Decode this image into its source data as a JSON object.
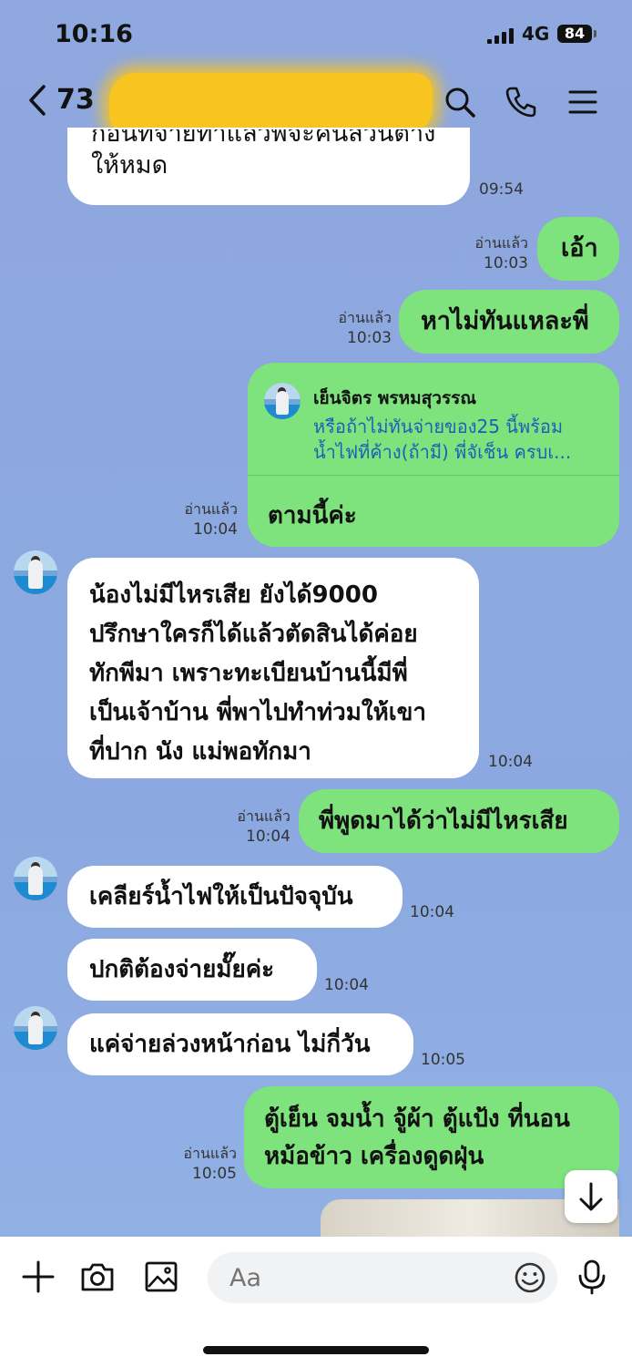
{
  "status": {
    "time": "10:16",
    "network": "4G",
    "battery": "84"
  },
  "header": {
    "unread_count": "73"
  },
  "messages": {
    "m1": {
      "text_line1": "ก่อนที่จ่ายทำแล้วพี่จะคืนส่วนต่าง",
      "text_line2": "ให้หมด",
      "time": "09:54"
    },
    "m2": {
      "text": "เอ้า",
      "read": "อ่านแล้ว",
      "time": "10:03"
    },
    "m3": {
      "text": "หาไม่ทันแหละพี่",
      "read": "อ่านแล้ว",
      "time": "10:03"
    },
    "m4": {
      "reply_name": "เย็นจิตร พรหมสุวรรณ",
      "reply_line1": "หรือถ้าไม่ทันจ่ายของ25 นี้พร้อม",
      "reply_line2": "น้ำไฟที่ค้าง(ถ้ามี) พี่จัเช็น ครบเ...",
      "text": "ตามนี้ค่ะ",
      "read": "อ่านแล้ว",
      "time": "10:04"
    },
    "m5": {
      "lines": [
        "น้องไม่มีไหรเสีย ยังได้9000",
        "ปรึกษาใครก็ได้แล้วตัดสินได้ค่อย",
        "ทักพีมา เพราะทะเบียนบ้านนี้มีพี่",
        "เป็นเจ้าบ้าน พี่พาไปทำท่วมให้เขา",
        "ที่ปาก นัง  แม่พอทักมา"
      ],
      "time": "10:04"
    },
    "m6": {
      "text": "พี่พูดมาได้ว่าไม่มีไหรเสีย",
      "read": "อ่านแล้ว",
      "time": "10:04"
    },
    "m7": {
      "text": "เคลียร์น้ำไฟให้เป็นปัจจุบัน",
      "time": "10:04"
    },
    "m8": {
      "text": "ปกติต้องจ่ายมั๊ยค่ะ",
      "time": "10:04"
    },
    "m9": {
      "text": "แค่จ่ายล่วงหน้าก่อน ไม่กี่วัน",
      "time": "10:05"
    },
    "m10": {
      "line1": "ตู้เย็น จมน้ำ จู้ผ้า ตู้แป้ง ที่นอน",
      "line2": "หม้อข้าว เครื่องดูดฝุ่น",
      "read": "อ่านแล้ว",
      "time": "10:05"
    }
  },
  "input": {
    "placeholder": "Aa"
  },
  "icons": {
    "back": "chevron-left-icon",
    "search": "search-icon",
    "call": "phone-icon",
    "menu": "menu-icon",
    "plus": "plus-icon",
    "camera": "camera-icon",
    "image": "image-icon",
    "emoji": "emoji-icon",
    "mic": "microphone-icon",
    "scroll": "arrow-down-icon"
  },
  "colors": {
    "background": "#8fa8df",
    "outgoing": "#7ee37c",
    "incoming": "#ffffff",
    "redaction": "#f7c420"
  }
}
